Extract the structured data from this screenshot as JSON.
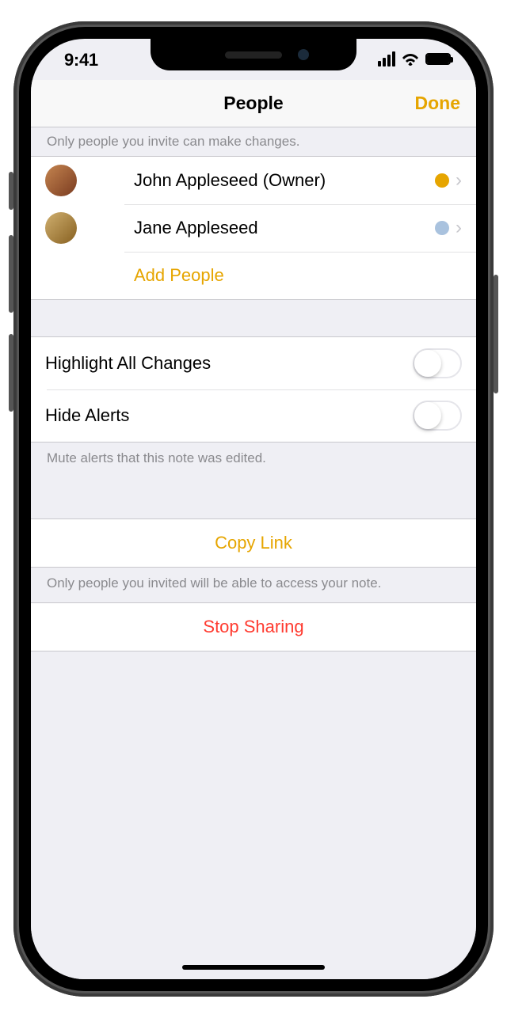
{
  "statusbar": {
    "time": "9:41"
  },
  "nav": {
    "title": "People",
    "done": "Done"
  },
  "peopleSection": {
    "header": "Only people you invite can make changes.",
    "rows": [
      {
        "name": "John Appleseed (Owner)"
      },
      {
        "name": "Jane Appleseed"
      }
    ],
    "addPeople": "Add People"
  },
  "settings": {
    "highlight": "Highlight All Changes",
    "hideAlerts": "Hide Alerts",
    "footer": "Mute alerts that this note was edited."
  },
  "link": {
    "copy": "Copy Link",
    "footer": "Only people you invited will be able to access your note."
  },
  "stop": {
    "label": "Stop Sharing"
  }
}
